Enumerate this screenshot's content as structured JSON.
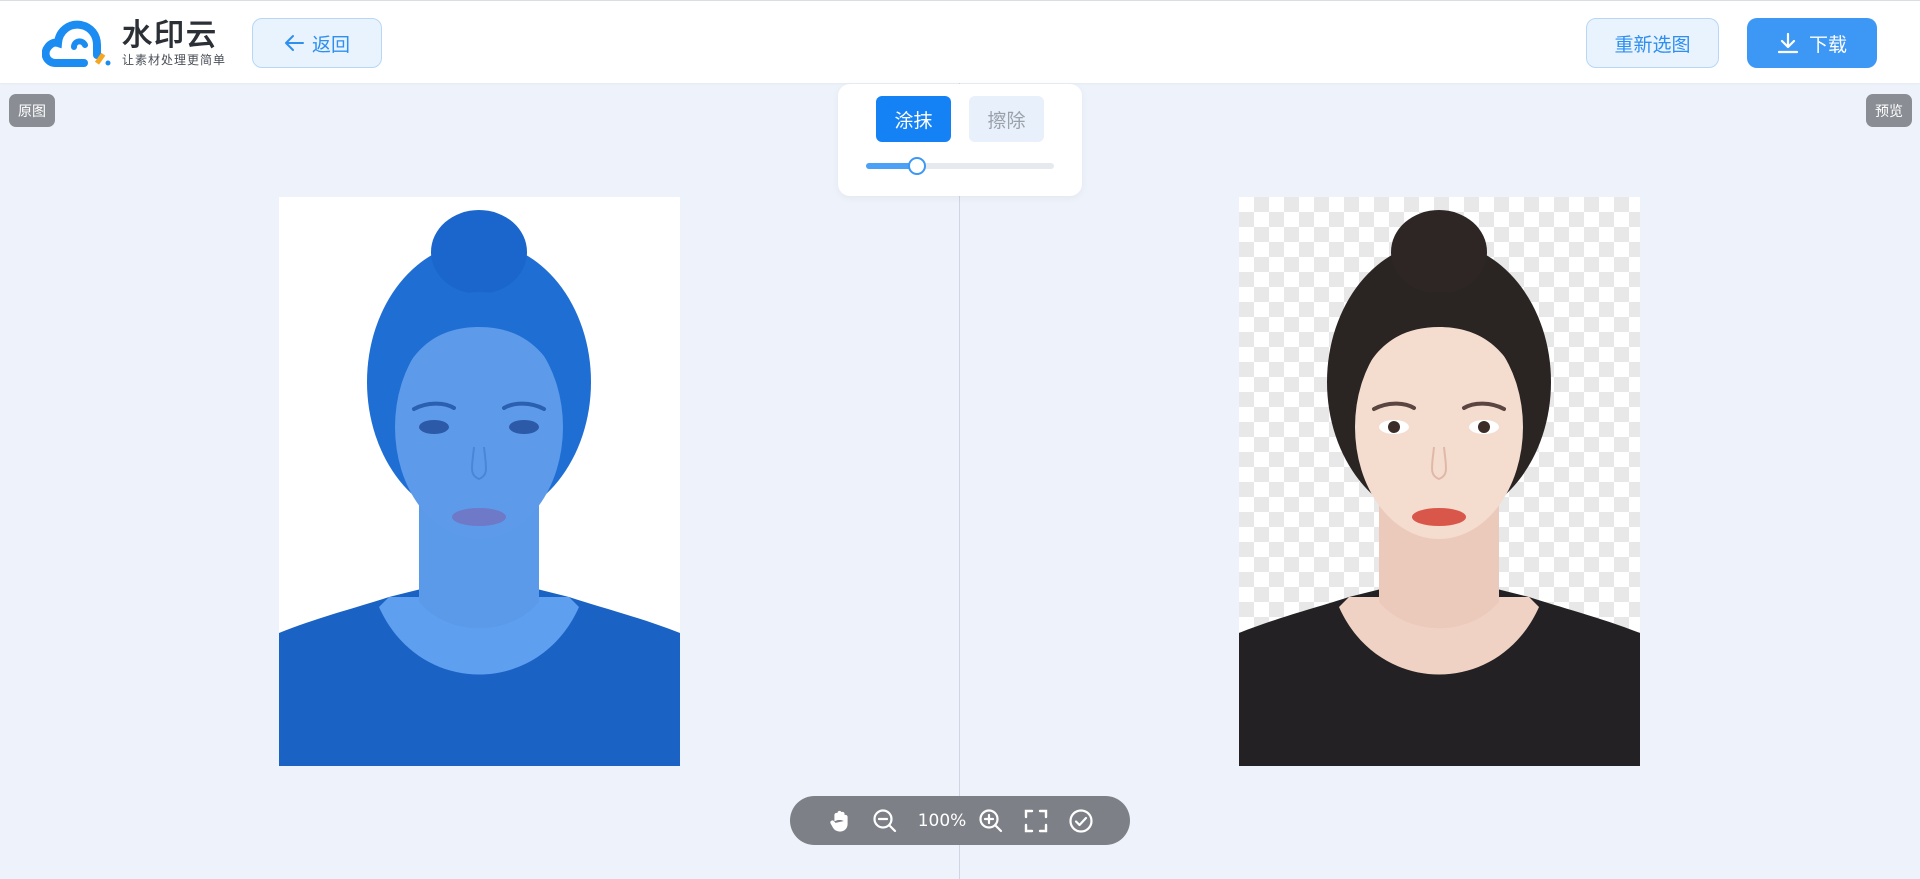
{
  "brand": {
    "name": "水印云",
    "tagline": "让素材处理更简单",
    "colors": {
      "primary": "#3d97f5",
      "primary_light": "#e9f3fe",
      "accent": "#f5a623"
    }
  },
  "header": {
    "back_label": "返回",
    "reselect_label": "重新选图",
    "download_label": "下载"
  },
  "labels": {
    "original": "原图",
    "preview": "预览"
  },
  "tool_panel": {
    "paint_label": "涂抹",
    "erase_label": "擦除",
    "active_tool": "paint",
    "brush_size_fraction": 0.27
  },
  "toolbar": {
    "icons": [
      "hand-icon",
      "zoom-out-icon",
      "zoom-in-icon",
      "fullscreen-icon",
      "confirm-icon"
    ],
    "zoom_label": "100%"
  }
}
